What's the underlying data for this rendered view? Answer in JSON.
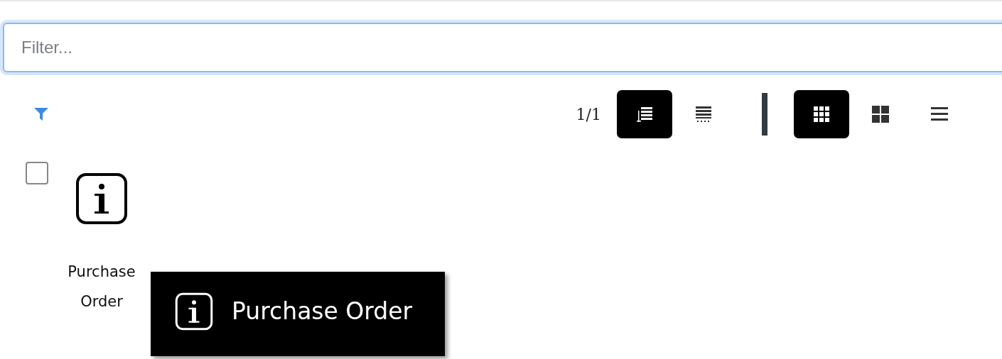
{
  "filter": {
    "placeholder": "Filter..."
  },
  "toolbar": {
    "pager": "1/1",
    "sort_buttons": [
      {
        "kind": "sorted-list",
        "selected": true
      },
      {
        "kind": "list-with-ellipsis",
        "selected": false
      }
    ],
    "view_buttons": [
      {
        "kind": "small-grid",
        "selected": true
      },
      {
        "kind": "large-grid",
        "selected": false
      },
      {
        "kind": "list",
        "selected": false
      }
    ]
  },
  "items": [
    {
      "label": "Purchase Order",
      "checked": false
    }
  ],
  "tooltip": {
    "label": "Purchase Order"
  }
}
